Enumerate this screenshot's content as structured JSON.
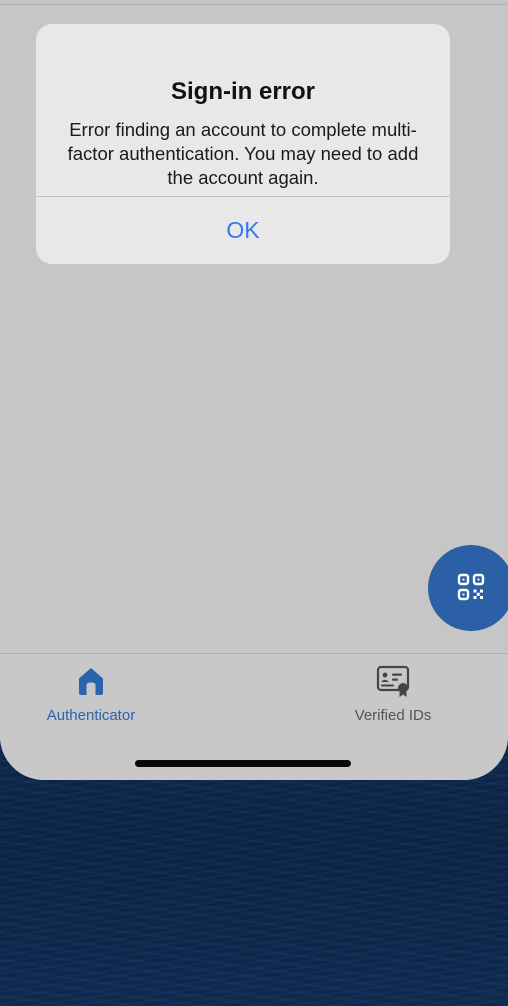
{
  "alert": {
    "title": "Sign-in error",
    "message": "Error finding an account to complete multi-factor authentication. You may need to add the account again.",
    "ok_label": "OK"
  },
  "fab": {
    "icon": "qr-code-icon"
  },
  "tabbar": {
    "items": [
      {
        "label": "Authenticator",
        "icon": "home-icon",
        "active": true
      },
      {
        "label": "Verified IDs",
        "icon": "id-card-icon",
        "active": false
      }
    ]
  },
  "colors": {
    "accent": "#2b63ad",
    "alert_button": "#3478f6",
    "overlay_background": "#c6c6c6",
    "wallpaper": "#0d2850"
  }
}
